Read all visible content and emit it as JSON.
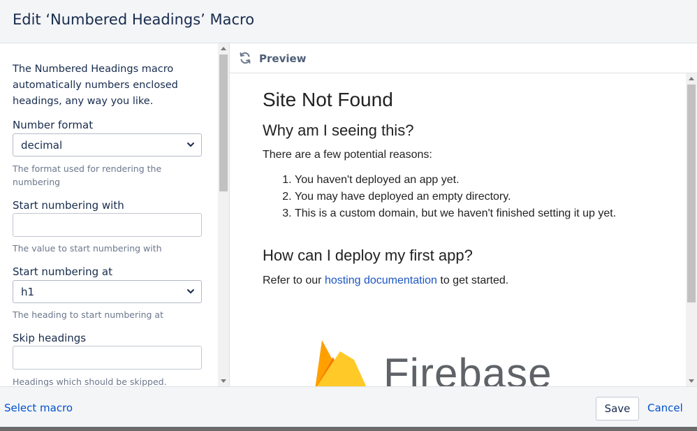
{
  "dialog": {
    "title": "Edit ‘Numbered Headings’ Macro"
  },
  "left_panel": {
    "description": "The Numbered Headings macro automatically numbers enclosed headings, any way you like.",
    "fields": {
      "number_format": {
        "label": "Number format",
        "value": "decimal",
        "help": "The format used for rendering the numbering"
      },
      "start_with": {
        "label": "Start numbering with",
        "value": "",
        "help": "The value to start numbering with"
      },
      "start_at": {
        "label": "Start numbering at",
        "value": "h1",
        "help": "The heading to start numbering at"
      },
      "skip_headings": {
        "label": "Skip headings",
        "value": "",
        "help": "Headings which should be skipped."
      }
    }
  },
  "preview": {
    "label": "Preview",
    "icon": "refresh-icon",
    "content": {
      "h1": "Site Not Found",
      "h2_reason": "Why am I seeing this?",
      "intro": "There are a few potential reasons:",
      "reasons": [
        "You haven't deployed an app yet.",
        "You may have deployed an empty directory.",
        "This is a custom domain, but we haven't finished setting it up yet."
      ],
      "h2_deploy": "How can I deploy my first app?",
      "refer_prefix": "Refer to our",
      "refer_link": "hosting documentation",
      "refer_suffix": "to get started.",
      "brand": "Firebase"
    }
  },
  "footer": {
    "select_macro": "Select macro",
    "save": "Save",
    "cancel": "Cancel"
  },
  "colors": {
    "link": "#0052cc",
    "header_bg": "#f4f5f7",
    "firebase_orange": "#f5820d",
    "firebase_yellow": "#ffca28"
  }
}
